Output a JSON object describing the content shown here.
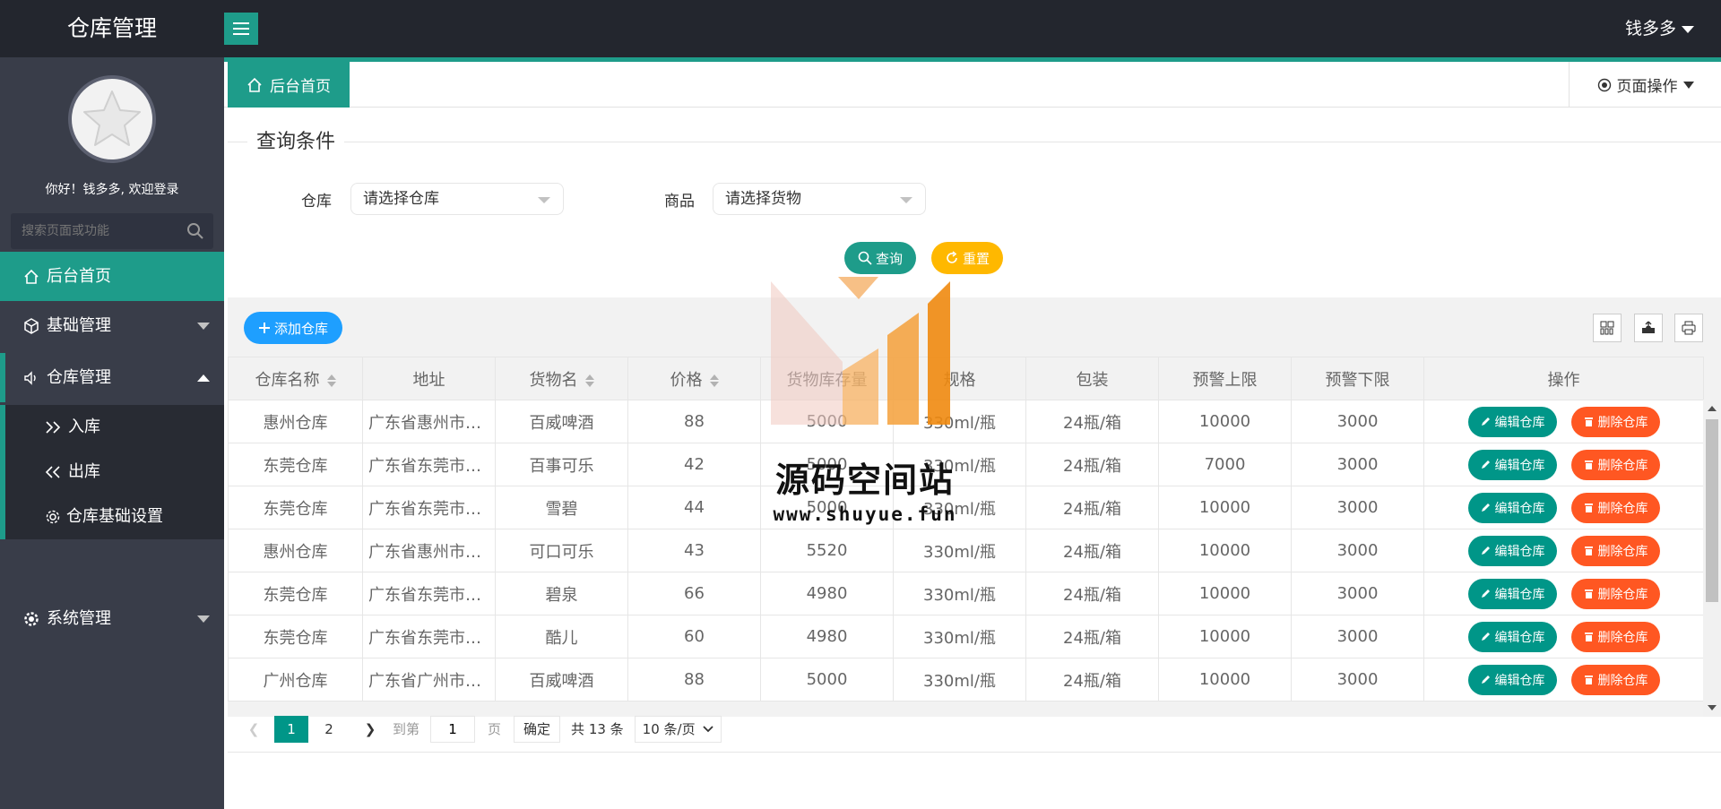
{
  "app": {
    "title": "仓库管理"
  },
  "header": {
    "user_name": "钱多多"
  },
  "sidebar": {
    "welcome": "你好！钱多多, 欢迎登录",
    "search_placeholder": "搜索页面或功能",
    "items": [
      {
        "label": "后台首页"
      },
      {
        "label": "基础管理"
      },
      {
        "label": "仓库管理"
      },
      {
        "label": "系统管理"
      }
    ],
    "sub_items": [
      {
        "label": "入库"
      },
      {
        "label": "出库"
      },
      {
        "label": "仓库基础设置"
      }
    ]
  },
  "tabs": {
    "home": "后台首页",
    "page_ops": "页面操作"
  },
  "query": {
    "legend": "查询条件",
    "warehouse_label": "仓库",
    "warehouse_placeholder": "请选择仓库",
    "goods_label": "商品",
    "goods_placeholder": "请选择货物",
    "search_btn": "查询",
    "reset_btn": "重置"
  },
  "toolbar": {
    "add_btn": "添加仓库"
  },
  "table": {
    "headers": [
      "仓库名称",
      "地址",
      "货物名",
      "价格",
      "货物库存量",
      "规格",
      "包装",
      "预警上限",
      "预警下限",
      "操作"
    ],
    "rows": [
      [
        "惠州仓库",
        "广东省惠州市惠城区",
        "百威啤酒",
        "88",
        "5000",
        "330ml/瓶",
        "24瓶/箱",
        "10000",
        "3000"
      ],
      [
        "东莞仓库",
        "广东省东莞市南城区",
        "百事可乐",
        "42",
        "5000",
        "330ml/瓶",
        "24瓶/箱",
        "7000",
        "3000"
      ],
      [
        "东莞仓库",
        "广东省东莞市南城区",
        "雪碧",
        "44",
        "5000",
        "330ml/瓶",
        "24瓶/箱",
        "10000",
        "3000"
      ],
      [
        "惠州仓库",
        "广东省惠州市惠城区",
        "可口可乐",
        "43",
        "5520",
        "330ml/瓶",
        "24瓶/箱",
        "10000",
        "3000"
      ],
      [
        "东莞仓库",
        "广东省东莞市南城区",
        "碧泉",
        "66",
        "4980",
        "330ml/瓶",
        "24瓶/箱",
        "10000",
        "3000"
      ],
      [
        "东莞仓库",
        "广东省东莞市南城区",
        "酷儿",
        "60",
        "4980",
        "330ml/瓶",
        "24瓶/箱",
        "10000",
        "3000"
      ],
      [
        "广州仓库",
        "广东省广州市天河区",
        "百威啤酒",
        "88",
        "5000",
        "330ml/瓶",
        "24瓶/箱",
        "10000",
        "3000"
      ]
    ],
    "edit_label": "编辑仓库",
    "delete_label": "删除仓库"
  },
  "pager": {
    "current": "1",
    "next_page": "2",
    "goto_prefix": "到第",
    "goto_value": "1",
    "goto_suffix": "页",
    "confirm": "确定",
    "total": "共 13 条",
    "page_size": "10 条/页"
  },
  "watermark": {
    "title": "源码空间站",
    "url": "www.shuyue.fun"
  },
  "colors": {
    "teal": "#1e9c8a",
    "blue": "#1e9fff",
    "orange": "#ff5722",
    "yellow": "#ffb800",
    "sidebar": "#393d49",
    "header": "#23262e"
  }
}
